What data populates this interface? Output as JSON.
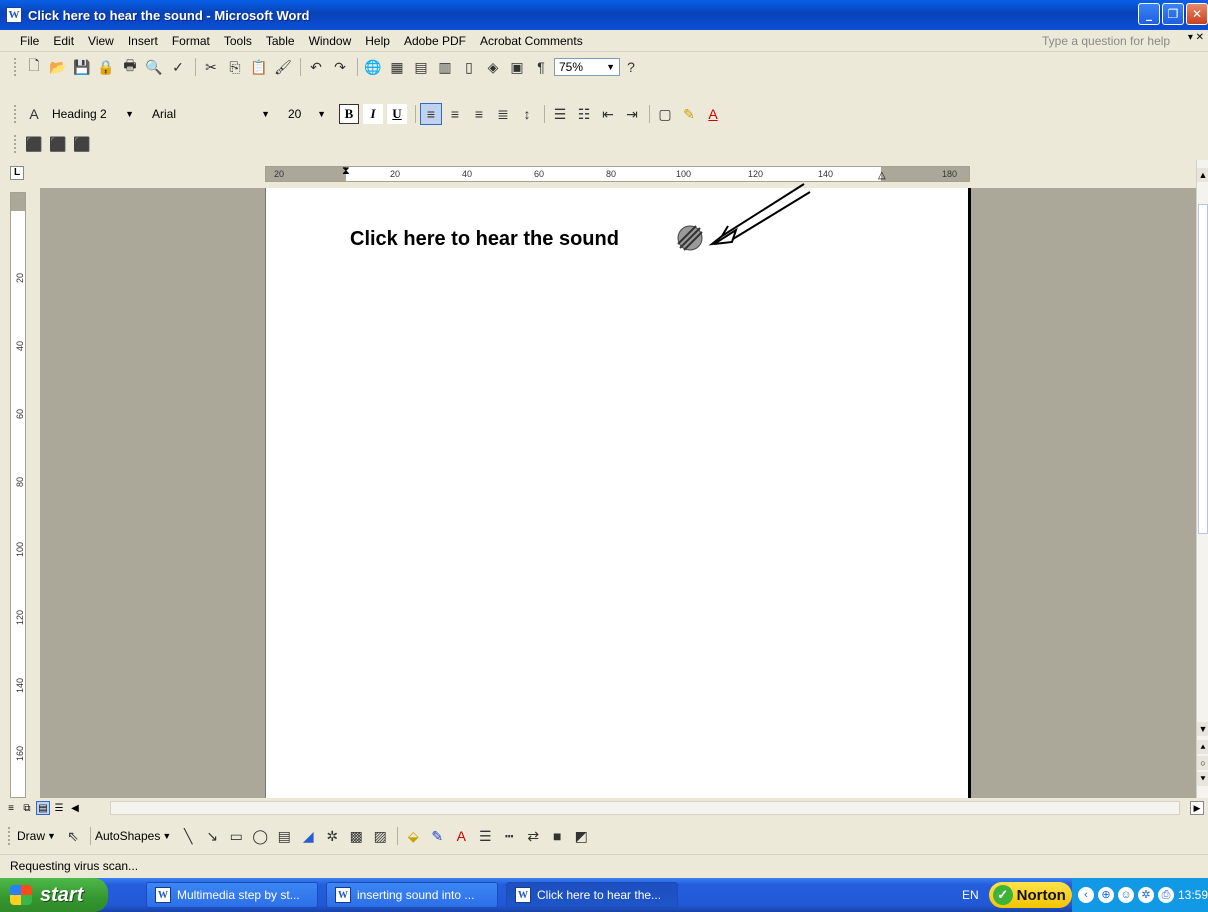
{
  "window": {
    "title": "Click here to hear the sound - Microsoft Word",
    "app_icon": "word-doc-icon",
    "controls": [
      "minimize-icon",
      "restore-icon",
      "close-icon"
    ]
  },
  "menu": {
    "items": [
      "File",
      "Edit",
      "View",
      "Insert",
      "Format",
      "Tools",
      "Table",
      "Window",
      "Help",
      "Adobe PDF",
      "Acrobat Comments"
    ],
    "help_placeholder": "Type a question for help"
  },
  "standard_toolbar": {
    "zoom": "75%",
    "icons": [
      "new-icon",
      "open-icon",
      "save-icon",
      "permission-icon",
      "print-icon",
      "print-preview-icon",
      "spelling-icon",
      "cut-icon",
      "copy-icon",
      "paste-icon",
      "format-painter-icon",
      "undo-icon",
      "redo-icon",
      "hyperlink-icon",
      "tables-borders-icon",
      "insert-table-icon",
      "insert-excel-icon",
      "columns-icon",
      "drawing-icon",
      "document-map-icon",
      "show-hide-icon",
      "help-icon"
    ]
  },
  "formatting_toolbar": {
    "style": "Heading 2",
    "font": "Arial",
    "size": "20",
    "bold": "B",
    "italic": "I",
    "underline": "U"
  },
  "ruler": {
    "horizontal_labels": [
      "20",
      "20",
      "40",
      "60",
      "80",
      "100",
      "120",
      "140",
      "180"
    ],
    "vertical_labels": [
      "20",
      "40",
      "60",
      "80",
      "100",
      "120",
      "140",
      "160"
    ]
  },
  "document": {
    "heading_text": "Click here to hear the sound",
    "sound_object_icon": "sound-clip-icon",
    "annotation": "arrow-pointer-icon"
  },
  "drawing_toolbar": {
    "draw_label": "Draw",
    "autoshapes_label": "AutoShapes"
  },
  "status": {
    "text": "Requesting virus scan..."
  },
  "taskbar": {
    "start_label": "start",
    "tasks": [
      {
        "label": "Multimedia step by st...",
        "active": false
      },
      {
        "label": "inserting sound into ...",
        "active": false
      },
      {
        "label": "Click here to hear the...",
        "active": true
      }
    ],
    "language": "EN",
    "norton_label": "Norton",
    "clock": "13:59"
  }
}
